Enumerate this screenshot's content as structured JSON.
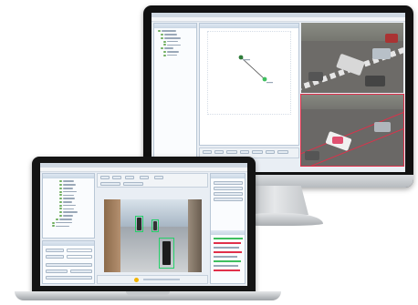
{
  "colors": {
    "device_frame": "#141414",
    "app_background": "#e9eef4",
    "panel_header": "#c9d6e4",
    "detection_green": "#25d06a",
    "selection_green": "#3fbf5f",
    "track_red": "#e0304a",
    "scene_road": "#6d6b68"
  },
  "icons": {
    "graph_node": "green-dot",
    "tree_node": "green-square"
  },
  "monitor": {
    "title": "",
    "video_feeds": 2
  },
  "laptop": {
    "title": "",
    "video_feeds": 1
  }
}
